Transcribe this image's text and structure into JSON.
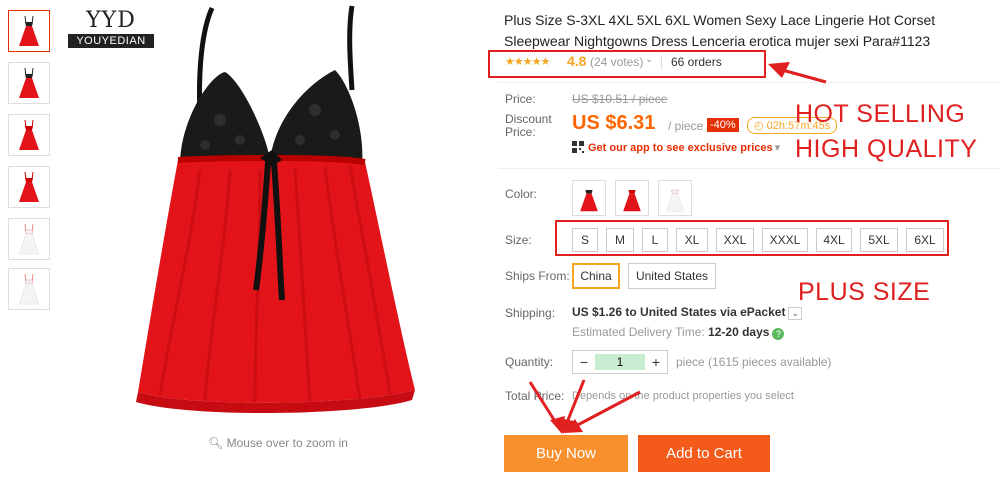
{
  "brand": {
    "line1": "YYD",
    "line2": "YOUYEDIAN"
  },
  "thumbnails": [
    {
      "variant": "black-red"
    },
    {
      "variant": "black-red"
    },
    {
      "variant": "red"
    },
    {
      "variant": "red"
    },
    {
      "variant": "white"
    },
    {
      "variant": "white"
    }
  ],
  "gallery": {
    "zoom_hint": "Mouse over to zoom in"
  },
  "product": {
    "title": "Plus Size S-3XL 4XL 5XL 6XL Women Sexy Lace Lingerie Hot Corset Sleepwear Nightgowns Dress Lenceria erotica mujer sexi Para#1123",
    "stars": "★★★★★",
    "rating": "4.8",
    "votes": "(24 votes)",
    "orders": "66 orders"
  },
  "pricing": {
    "price_label": "Price:",
    "old_price": "US $10.51 / piece",
    "discount_label_1": "Discount",
    "discount_label_2": "Price:",
    "new_price": "US $6.31",
    "per_piece": "/ piece",
    "discount_badge": "-40%",
    "timer": "02h:57m:45s",
    "app_promo": "Get our app to see exclusive prices"
  },
  "options": {
    "color_label": "Color:",
    "colors": [
      "black-red",
      "red",
      "white"
    ],
    "size_label": "Size:",
    "sizes": [
      "S",
      "M",
      "L",
      "XL",
      "XXL",
      "XXXL",
      "4XL",
      "5XL",
      "6XL"
    ],
    "ships_from_label": "Ships From:",
    "ships_from": [
      "China",
      "United States"
    ],
    "ships_from_selected": "China"
  },
  "shipping": {
    "label": "Shipping:",
    "cost": "US $1.26",
    "to_text": "to United States via ePacket",
    "delivery_label": "Estimated Delivery Time:",
    "delivery_value": "12-20 days"
  },
  "quantity": {
    "label": "Quantity:",
    "value": "1",
    "minus": "−",
    "plus": "+",
    "available": "piece (1615 pieces available)"
  },
  "total": {
    "label": "Total Price:",
    "note": "Depends on the product properties you select"
  },
  "actions": {
    "buy_now": "Buy Now",
    "add_to_cart": "Add to Cart"
  },
  "annotations": {
    "hot_selling": "HOT SELLING",
    "high_quality": "HIGH QUALITY",
    "plus_size": "PLUS SIZE"
  },
  "colors": {
    "accent_red": "#e01f1f",
    "price_orange": "#ff6600",
    "star": "#f5a623",
    "buy": "#f8902e",
    "cart": "#f45b1b"
  }
}
